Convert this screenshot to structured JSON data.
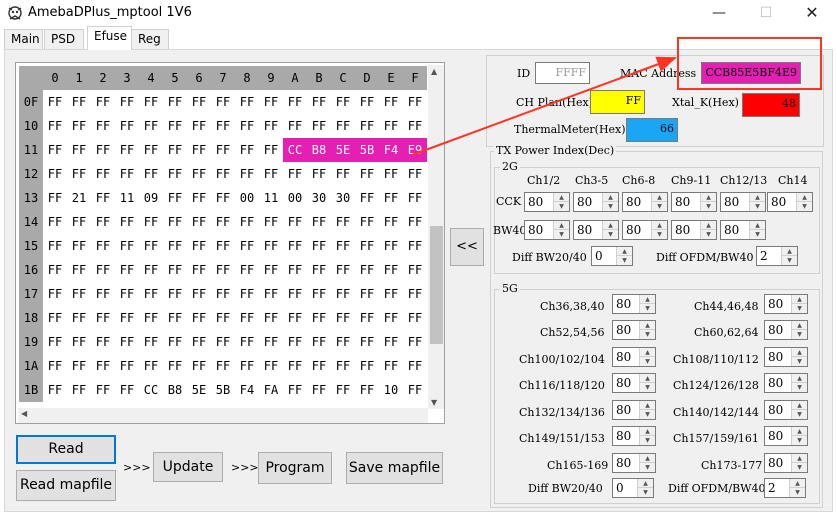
{
  "window": {
    "title": "AmebaDPlus_mptool 1V6",
    "minimize": "—",
    "maximize": "☐",
    "close": "✕"
  },
  "tabs": [
    {
      "label": "Main",
      "active": false
    },
    {
      "label": "PSD",
      "active": false
    },
    {
      "label": "Efuse",
      "active": true
    },
    {
      "label": "Reg",
      "active": false
    }
  ],
  "efuse": {
    "col_headers": [
      "0",
      "1",
      "2",
      "3",
      "4",
      "5",
      "6",
      "7",
      "8",
      "9",
      "A",
      "B",
      "C",
      "D",
      "E",
      "F"
    ],
    "rows": [
      {
        "addr": "0F",
        "cells": [
          "FF",
          "FF",
          "FF",
          "FF",
          "FF",
          "FF",
          "FF",
          "FF",
          "FF",
          "FF",
          "FF",
          "FF",
          "FF",
          "FF",
          "FF",
          "FF"
        ]
      },
      {
        "addr": "10",
        "cells": [
          "FF",
          "FF",
          "FF",
          "FF",
          "FF",
          "FF",
          "FF",
          "FF",
          "FF",
          "FF",
          "FF",
          "FF",
          "FF",
          "FF",
          "FF",
          "FF"
        ]
      },
      {
        "addr": "11",
        "cells": [
          "FF",
          "FF",
          "FF",
          "FF",
          "FF",
          "FF",
          "FF",
          "FF",
          "FF",
          "FF",
          "CC",
          "B8",
          "5E",
          "5B",
          "F4",
          "E9"
        ]
      },
      {
        "addr": "12",
        "cells": [
          "FF",
          "FF",
          "FF",
          "FF",
          "FF",
          "FF",
          "FF",
          "FF",
          "FF",
          "FF",
          "FF",
          "FF",
          "FF",
          "FF",
          "FF",
          "FF"
        ]
      },
      {
        "addr": "13",
        "cells": [
          "FF",
          "21",
          "FF",
          "11",
          "09",
          "FF",
          "FF",
          "FF",
          "00",
          "11",
          "00",
          "30",
          "30",
          "FF",
          "FF",
          "FF"
        ]
      },
      {
        "addr": "14",
        "cells": [
          "FF",
          "FF",
          "FF",
          "FF",
          "FF",
          "FF",
          "FF",
          "FF",
          "FF",
          "FF",
          "FF",
          "FF",
          "FF",
          "FF",
          "FF",
          "FF"
        ]
      },
      {
        "addr": "15",
        "cells": [
          "FF",
          "FF",
          "FF",
          "FF",
          "FF",
          "FF",
          "FF",
          "FF",
          "FF",
          "FF",
          "FF",
          "FF",
          "FF",
          "FF",
          "FF",
          "FF"
        ]
      },
      {
        "addr": "16",
        "cells": [
          "FF",
          "FF",
          "FF",
          "FF",
          "FF",
          "FF",
          "FF",
          "FF",
          "FF",
          "FF",
          "FF",
          "FF",
          "FF",
          "FF",
          "FF",
          "FF"
        ]
      },
      {
        "addr": "17",
        "cells": [
          "FF",
          "FF",
          "FF",
          "FF",
          "FF",
          "FF",
          "FF",
          "FF",
          "FF",
          "FF",
          "FF",
          "FF",
          "FF",
          "FF",
          "FF",
          "FF"
        ]
      },
      {
        "addr": "18",
        "cells": [
          "FF",
          "FF",
          "FF",
          "FF",
          "FF",
          "FF",
          "FF",
          "FF",
          "FF",
          "FF",
          "FF",
          "FF",
          "FF",
          "FF",
          "FF",
          "FF"
        ]
      },
      {
        "addr": "19",
        "cells": [
          "FF",
          "FF",
          "FF",
          "FF",
          "FF",
          "FF",
          "FF",
          "FF",
          "FF",
          "FF",
          "FF",
          "FF",
          "FF",
          "FF",
          "FF",
          "FF"
        ]
      },
      {
        "addr": "1A",
        "cells": [
          "FF",
          "FF",
          "FF",
          "FF",
          "FF",
          "FF",
          "FF",
          "FF",
          "FF",
          "FF",
          "FF",
          "FF",
          "FF",
          "FF",
          "FF",
          "FF"
        ]
      },
      {
        "addr": "1B",
        "cells": [
          "FF",
          "FF",
          "FF",
          "FF",
          "CC",
          "B8",
          "5E",
          "5B",
          "F4",
          "FA",
          "FF",
          "FF",
          "FF",
          "FF",
          "10",
          "FF"
        ]
      }
    ],
    "highlight_row": 2,
    "highlight_cols": [
      10,
      11,
      12,
      13,
      14,
      15
    ],
    "highlight_color": "#e51fb4"
  },
  "buttons": {
    "read": "Read",
    "read_mapfile": "Read mapfile",
    "update": "Update",
    "program": "Program",
    "save_mapfile": "Save mapfile",
    "copy_left": "<<",
    "arrow1": ">>>",
    "arrow2": ">>>"
  },
  "info": {
    "id_label": "ID",
    "id_value": "FFFF",
    "mac_label": "MAC Address",
    "mac_value": "CCB85E5BF4E9",
    "mac_color": "#e51fb4",
    "chplan_label": "CH Plan(Hex)",
    "chplan_value": "FF",
    "chplan_color": "#ffff00",
    "xtal_label": "Xtal_K(Hex)",
    "xtal_value": "48",
    "xtal_color": "#ff0000",
    "thermal_label": "ThermalMeter(Hex)",
    "thermal_value": "66",
    "thermal_color": "#19a7f5"
  },
  "txpower": {
    "title": "TX Power Index(Dec)",
    "g2_title": "2G",
    "g2_headers": [
      "Ch1/2",
      "Ch3-5",
      "Ch6-8",
      "Ch9-11",
      "Ch12/13",
      "Ch14"
    ],
    "cck_label": "CCK",
    "cck_values": [
      "80",
      "80",
      "80",
      "80",
      "80",
      "80"
    ],
    "bw40_label": "BW40",
    "bw40_values": [
      "80",
      "80",
      "80",
      "80",
      "80"
    ],
    "diff_bw2040_label": "Diff BW20/40",
    "diff_bw2040_value": "0",
    "diff_ofdm_bw40_label": "Diff OFDM/BW40",
    "diff_ofdm_bw40_value": "2",
    "g5_title": "5G",
    "g5_left": [
      {
        "label": "Ch36,38,40",
        "value": "80"
      },
      {
        "label": "Ch52,54,56",
        "value": "80"
      },
      {
        "label": "Ch100/102/104",
        "value": "80"
      },
      {
        "label": "Ch116/118/120",
        "value": "80"
      },
      {
        "label": "Ch132/134/136",
        "value": "80"
      },
      {
        "label": "Ch149/151/153",
        "value": "80"
      },
      {
        "label": "Ch165-169",
        "value": "80"
      }
    ],
    "g5_right": [
      {
        "label": "Ch44,46,48",
        "value": "80"
      },
      {
        "label": "Ch60,62,64",
        "value": "80"
      },
      {
        "label": "Ch108/110/112",
        "value": "80"
      },
      {
        "label": "Ch124/126/128",
        "value": "80"
      },
      {
        "label": "Ch140/142/144",
        "value": "80"
      },
      {
        "label": "Ch157/159/161",
        "value": "80"
      },
      {
        "label": "Ch173-177",
        "value": "80"
      }
    ],
    "g5_diff_bw_label": "Diff BW20/40",
    "g5_diff_bw_value": "0",
    "g5_diff_ofdm_label": "Diff OFDM/BW40",
    "g5_diff_ofdm_value": "2"
  },
  "annotation_color": "#ff3322"
}
